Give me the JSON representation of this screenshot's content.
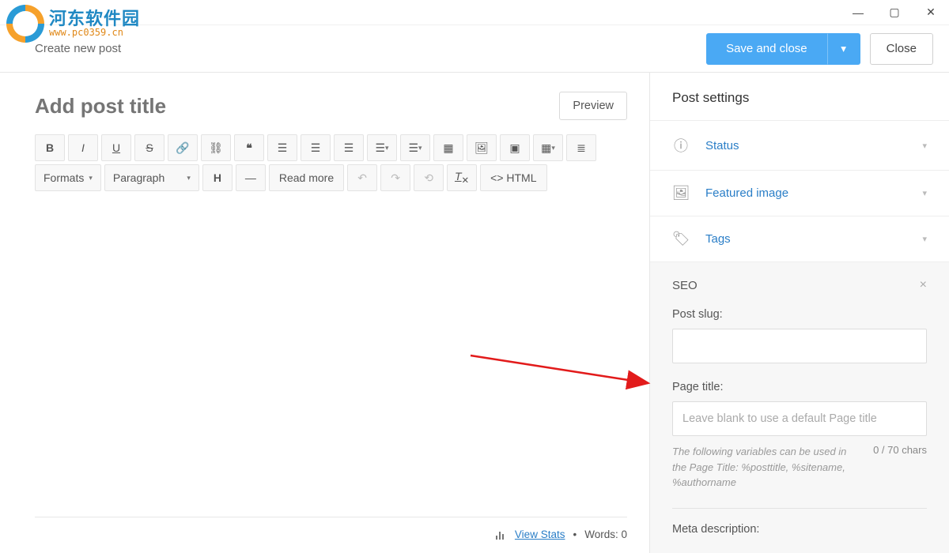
{
  "window": {
    "min": "—",
    "max": "▢",
    "close": "✕"
  },
  "header": {
    "title": "Create new post",
    "save_label": "Save and close",
    "close_label": "Close"
  },
  "editor": {
    "title_placeholder": "Add post title",
    "preview_label": "Preview",
    "toolbar": {
      "formats": "Formats",
      "paragraph": "Paragraph",
      "readmore": "Read more",
      "html": "HTML"
    },
    "footer": {
      "view_stats": "View Stats",
      "words_label": "Words:",
      "words_count": "0"
    }
  },
  "sidebar": {
    "heading": "Post settings",
    "items": [
      {
        "label": "Status"
      },
      {
        "label": "Featured image"
      },
      {
        "label": "Tags"
      }
    ],
    "seo": {
      "title": "SEO",
      "slug_label": "Post slug:",
      "slug_value": "",
      "page_title_label": "Page title:",
      "page_title_placeholder": "Leave blank to use a default Page title",
      "page_title_help": "The following variables can be used in the Page Title: %posttitle, %sitename, %authorname",
      "page_title_chars": "0 / 70 chars",
      "meta_label": "Meta description:"
    }
  },
  "watermark": {
    "cn": "河东软件园",
    "url": "www.pc0359.cn"
  }
}
